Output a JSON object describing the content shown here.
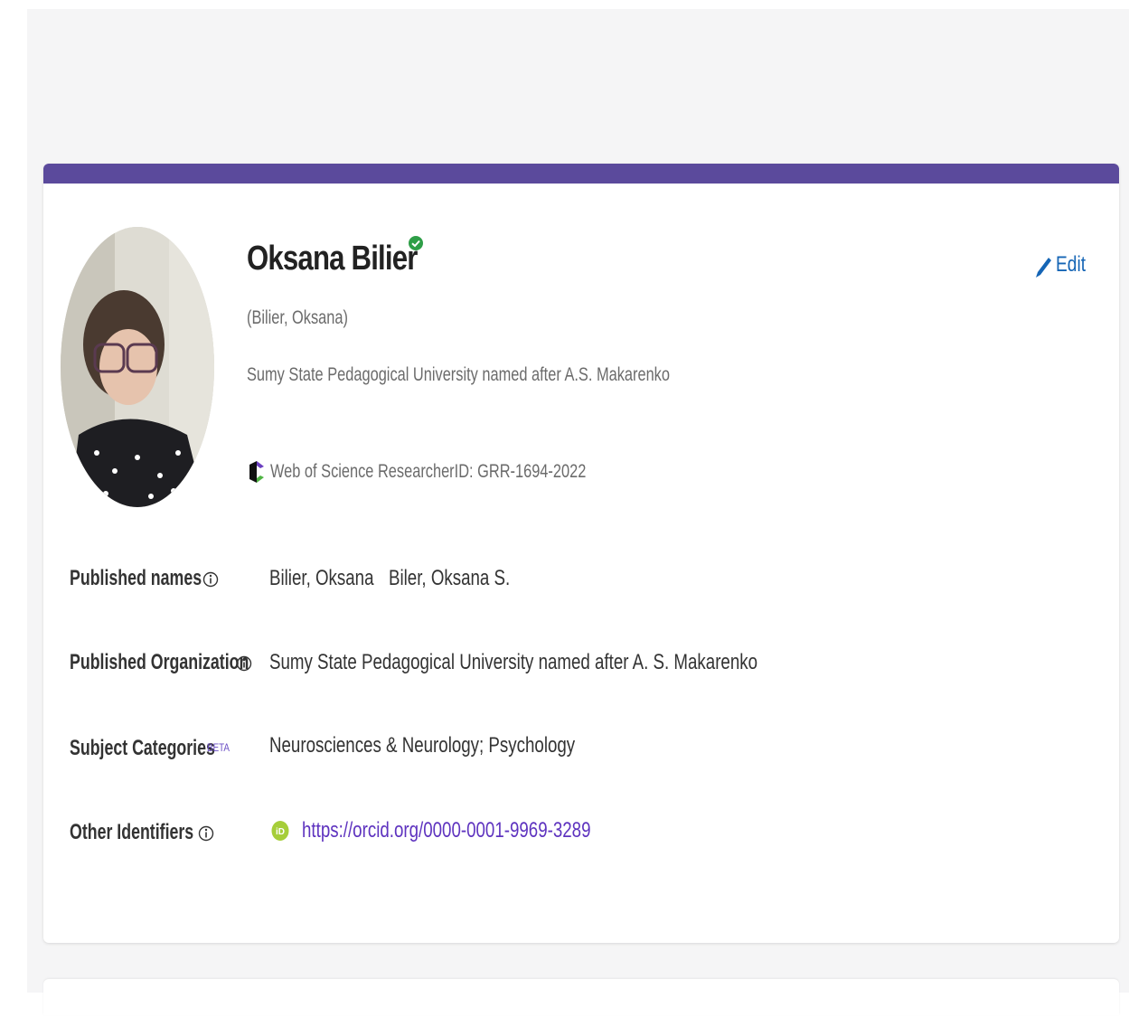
{
  "profile": {
    "name": "Oksana Bilier",
    "alt_name": "(Bilier, Oksana)",
    "affiliation": "Sumy State Pedagogical University named after A.S. Makarenko",
    "researcher_id": "Web of Science ResearcherID: GRR-1694-2022",
    "edit_label": "Edit"
  },
  "details": {
    "published_names": {
      "label": "Published names",
      "values": [
        "Bilier, Oksana",
        "Biler, Oksana S."
      ]
    },
    "published_organization": {
      "label": "Published Organization",
      "value": "Sumy State Pedagogical University named after A. S. Makarenko"
    },
    "subject_categories": {
      "label": "Subject Categories",
      "badge": "BETA",
      "value": "Neurosciences & Neurology;  Psychology"
    },
    "other_identifiers": {
      "label": "Other Identifiers",
      "orcid_url": "https://orcid.org/0000-0001-9969-3289"
    }
  },
  "icons": {
    "verified": "verified-check-icon",
    "wos": "web-of-science-icon",
    "edit": "pencil-icon",
    "info": "info-icon",
    "orcid": "orcid-icon"
  },
  "colors": {
    "accent_bar": "#5b4a9c",
    "verified": "#2e9e47",
    "edit": "#1565b5",
    "link": "#5e33bf",
    "orcid": "#a6ce39"
  }
}
